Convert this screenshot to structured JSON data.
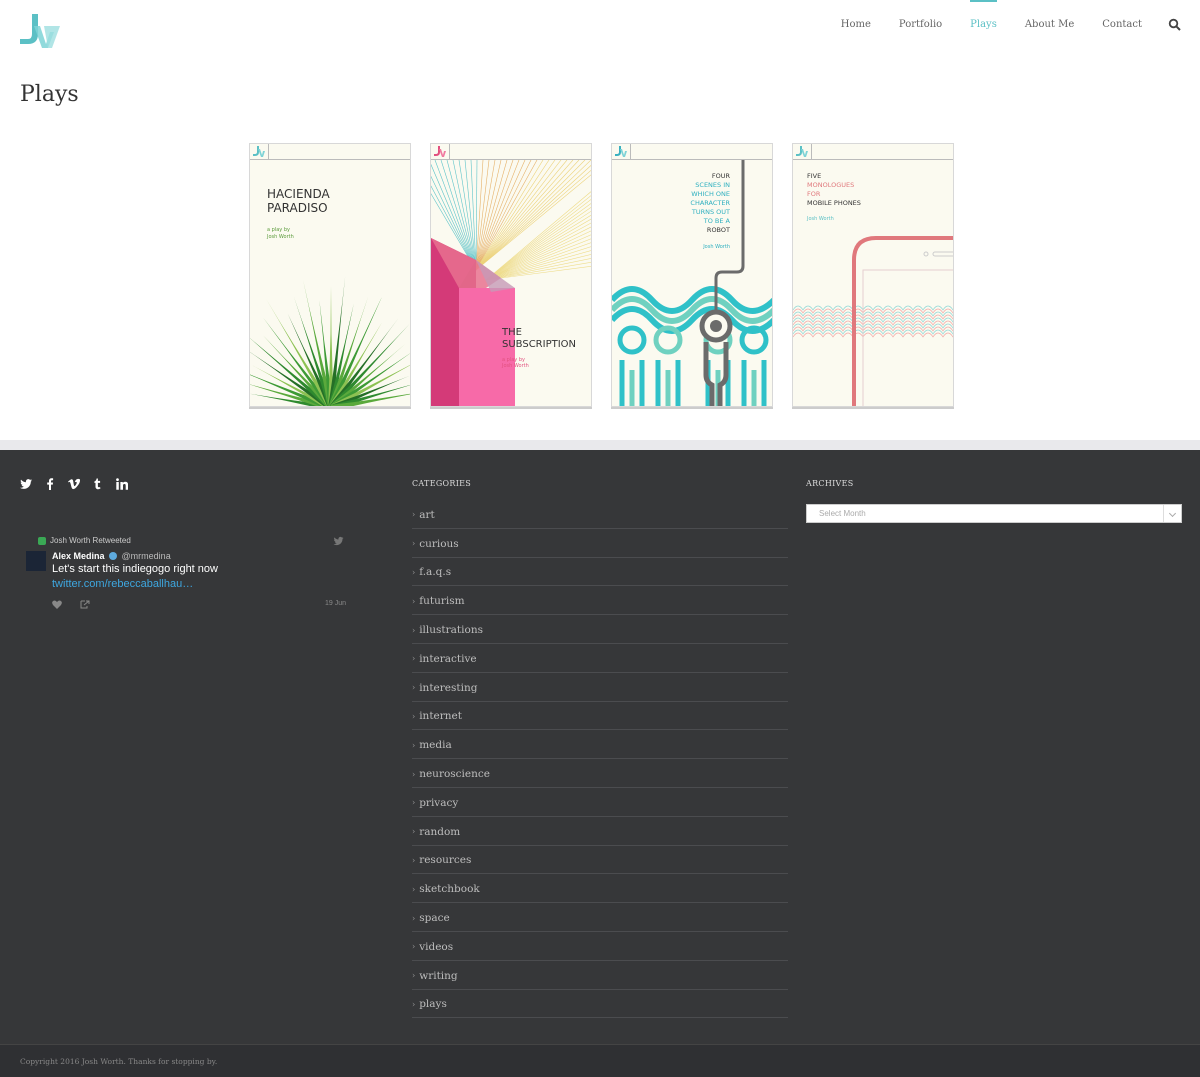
{
  "nav": {
    "items": [
      {
        "label": "Home",
        "active": false
      },
      {
        "label": "Portfolio",
        "active": false
      },
      {
        "label": "Plays",
        "active": true
      },
      {
        "label": "About Me",
        "active": false
      },
      {
        "label": "Contact",
        "active": false
      }
    ],
    "search_icon": "search-icon"
  },
  "page": {
    "title": "Plays"
  },
  "plays": [
    {
      "title_line1": "HACIENDA",
      "title_line2": "PARADISO",
      "byline1": "a play by",
      "byline2": "Josh Worth"
    },
    {
      "title_line1": "THE",
      "title_line2": "SUBSCRIPTION",
      "byline1": "a play by",
      "byline2": "Josh Worth"
    },
    {
      "lines": [
        "FOUR",
        "SCENES IN",
        "WHICH ONE",
        "CHARACTER",
        "TURNS OUT",
        "TO BE A",
        "ROBOT"
      ],
      "byline": "Josh Worth"
    },
    {
      "lines": [
        "FIVE",
        "MONOLOGUES",
        "FOR",
        "MOBILE PHONES"
      ],
      "byline": "Josh Worth"
    }
  ],
  "footer": {
    "social_icons": [
      "twitter-icon",
      "facebook-icon",
      "vimeo-icon",
      "tumblr-icon",
      "linkedin-icon"
    ],
    "tweet": {
      "retweeted_by": "Josh Worth Retweeted",
      "author_name": "Alex Medina",
      "author_handle": "@mrmedina",
      "text": "Let's start this indiegogo right now",
      "link": "twitter.com/rebeccaballhau…",
      "date": "19 Jun"
    },
    "categories": {
      "title": "CATEGORIES",
      "items": [
        "art",
        "curious",
        "f.a.q.s",
        "futurism",
        "illustrations",
        "interactive",
        "interesting",
        "internet",
        "media",
        "neuroscience",
        "privacy",
        "random",
        "resources",
        "sketchbook",
        "space",
        "videos",
        "writing",
        "plays"
      ]
    },
    "archives": {
      "title": "ARCHIVES",
      "select_placeholder": "Select Month"
    },
    "copyright": "Copyright 2016 Josh Worth. Thanks for stopping by."
  },
  "colors": {
    "accent": "#5bc0c5",
    "footer_bg": "#363739",
    "link_blue": "#3ea7e0"
  }
}
